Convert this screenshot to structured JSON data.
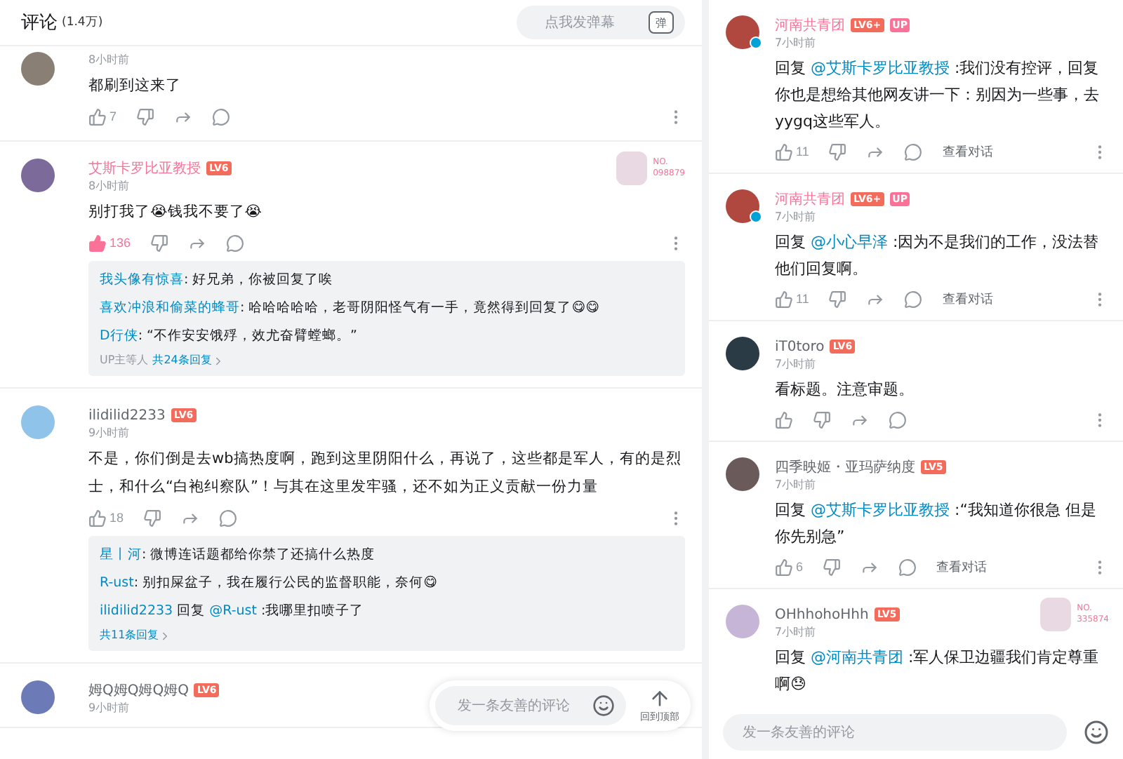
{
  "left": {
    "header": {
      "title": "评论",
      "count": "(1.4万)",
      "danmaku_placeholder": "点我发弹幕",
      "danmaku_button": "弹"
    },
    "comments": [
      {
        "time": "8小时前",
        "text": "都刷到这来了",
        "likes": "7",
        "liked": false
      },
      {
        "user": "艾斯卡罗比亚教授",
        "vip": true,
        "tags": [
          {
            "text": "LV6",
            "kind": "level"
          }
        ],
        "fan_badge": {
          "label": "NO.",
          "number": "098879"
        },
        "time": "8小时前",
        "text": "别打我了😭钱我不要了😭",
        "likes": "136",
        "liked": true,
        "replies": [
          {
            "author": "我头像有惊喜",
            "text": ": 好兄弟，你被回复了唉"
          },
          {
            "author": "喜欢冲浪和偷菜的蜂哥",
            "text": ": 哈哈哈哈哈，老哥阴阳怪气有一手，竟然得到回复了😋😋"
          },
          {
            "author": "D行侠",
            "text": ": “不作安安饿殍，效尤奋臂螳螂。”"
          }
        ],
        "replies_note": "UP主等人",
        "replies_more": "共24条回复"
      },
      {
        "user": "ilidilid2233",
        "vip": false,
        "tags": [
          {
            "text": "LV6",
            "kind": "level"
          }
        ],
        "time": "9小时前",
        "text": "不是，你们倒是去wb搞热度啊，跑到这里阴阳什么，再说了，这些都是军人，有的是烈士，和什么“白袍纠察队”！与其在这里发牢骚，还不如为正义贡献一份力量",
        "likes": "18",
        "liked": false,
        "replies": [
          {
            "author": "星丨河",
            "text": ": 微博连话题都给你禁了还搞什么热度"
          },
          {
            "author": "R-ust",
            "text": ": 别扣屎盆子，我在履行公民的监督职能，奈何😋"
          },
          {
            "author": "ilidilid2233",
            "reply_word": "回复",
            "mention": "@R-ust",
            "text": " :我哪里扣喷子了"
          }
        ],
        "replies_more": "共11条回复"
      },
      {
        "user": "姆Q姆Q姆Q姆Q",
        "vip": false,
        "tags": [
          {
            "text": "LV6",
            "kind": "level"
          }
        ],
        "time": "9小时前"
      }
    ],
    "float_bar": {
      "placeholder": "发一条友善的评论",
      "back_to_top": "回到顶部"
    }
  },
  "right": {
    "comments": [
      {
        "user": "河南共青团",
        "vip": true,
        "verified": true,
        "tags": [
          {
            "text": "LV6+",
            "kind": "level"
          },
          {
            "text": "UP",
            "kind": "up"
          }
        ],
        "time": "7小时前",
        "reply_word": "回复",
        "mention": "@艾斯卡罗比亚教授",
        "text": " :我们没有控评，回复你也是想给其他网友讲一下：别因为一些事，去yygq这些军人。",
        "likes": "11",
        "liked": false,
        "view_dialog": "查看对话"
      },
      {
        "user": "河南共青团",
        "vip": true,
        "verified": true,
        "tags": [
          {
            "text": "LV6+",
            "kind": "level"
          },
          {
            "text": "UP",
            "kind": "up"
          }
        ],
        "time": "7小时前",
        "reply_word": "回复",
        "mention": "@小心早泽",
        "text": " :因为不是我们的工作，没法替他们回复啊。",
        "likes": "11",
        "liked": false,
        "view_dialog": "查看对话"
      },
      {
        "user": "iT0toro",
        "vip": false,
        "verified": false,
        "tags": [
          {
            "text": "LV6",
            "kind": "level"
          }
        ],
        "time": "7小时前",
        "text": "看标题。注意审题。",
        "liked": false
      },
      {
        "user": "四季映姬・亚玛萨纳度",
        "vip": false,
        "verified": false,
        "tags": [
          {
            "text": "LV5",
            "kind": "level"
          }
        ],
        "time": "7小时前",
        "reply_word": "回复",
        "mention": "@艾斯卡罗比亚教授",
        "text": " :“我知道你很急 但是你先别急”",
        "likes": "6",
        "liked": false,
        "view_dialog": "查看对话"
      },
      {
        "user": "OHhhohoHhh",
        "vip": false,
        "verified": false,
        "tags": [
          {
            "text": "LV5",
            "kind": "level"
          }
        ],
        "fan_badge": {
          "label": "NO.",
          "number": "335874"
        },
        "time": "7小时前",
        "reply_word": "回复",
        "mention": "@河南共青团",
        "text": " :军人保卫边疆我们肯定尊重啊😓"
      }
    ],
    "input": {
      "placeholder": "发一条友善的评论"
    }
  }
}
